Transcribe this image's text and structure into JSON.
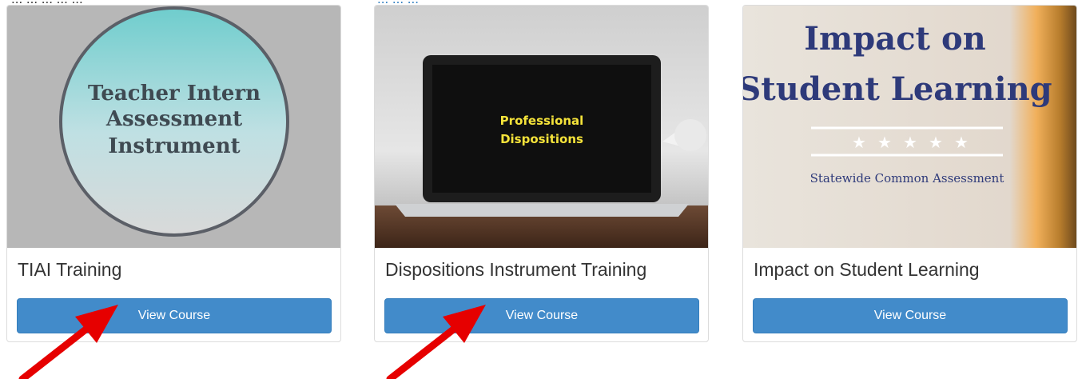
{
  "header_fragment": {
    "left_text": "... ... ... ... ...",
    "right_text": "... ... ..."
  },
  "cards": [
    {
      "title": "TIAI Training",
      "button": "View Course",
      "image_text": [
        "Teacher Intern",
        "Assessment",
        "Instrument"
      ]
    },
    {
      "title": "Dispositions Instrument Training",
      "button": "View Course",
      "image_text": [
        "Professional",
        "Dispositions"
      ]
    },
    {
      "title": "Impact on Student Learning",
      "button": "View Course",
      "image_text": [
        "Impact on",
        "Student Learning",
        "Statewide Common Assessment"
      ]
    }
  ],
  "colors": {
    "button": "#428bca",
    "annotation_arrow": "#e60000",
    "link": "#2a7bbf"
  }
}
